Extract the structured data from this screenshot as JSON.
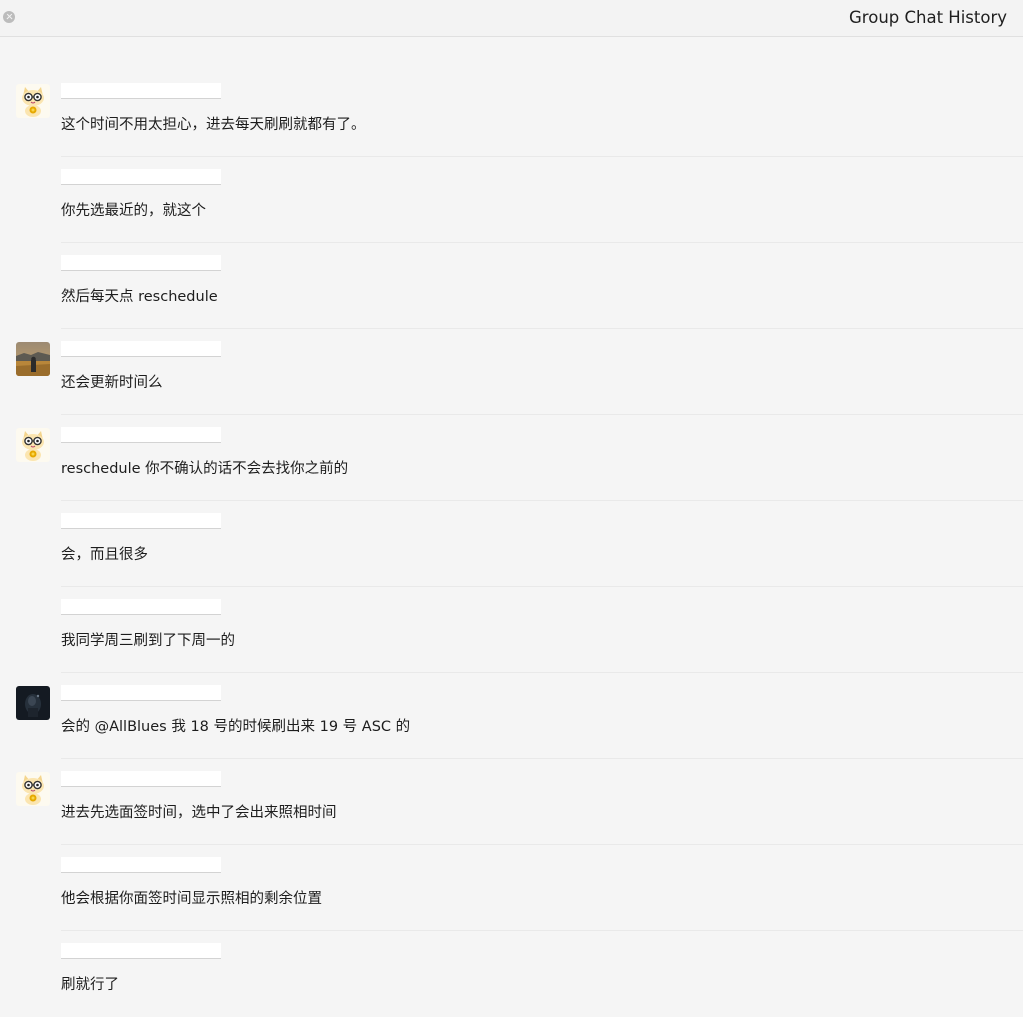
{
  "window": {
    "title": "Group Chat History",
    "close_icon": "close-icon"
  },
  "messages": [
    {
      "avatar": "cat-avatar",
      "text": "这个时间不用太担心，进去每天刷刷就都有了。"
    },
    {
      "avatar": null,
      "text": "你先选最近的，就这个"
    },
    {
      "avatar": null,
      "text": "然后每天点 reschedule"
    },
    {
      "avatar": "landscape-avatar",
      "text": "还会更新时间么"
    },
    {
      "avatar": "cat-avatar",
      "text": "reschedule 你不确认的话不会去找你之前的"
    },
    {
      "avatar": null,
      "text": "会，而且很多"
    },
    {
      "avatar": null,
      "text": "我同学周三刷到了下周一的"
    },
    {
      "avatar": "dark-avatar",
      "text": "会的 @AllBlues 我 18 号的时候刷出来 19 号 ASC 的"
    },
    {
      "avatar": "cat-avatar",
      "text": "进去先选面签时间，选中了会出来照相时间"
    },
    {
      "avatar": null,
      "text": "他会根据你面签时间显示照相的剩余位置"
    },
    {
      "avatar": null,
      "text": "刷就行了"
    }
  ]
}
